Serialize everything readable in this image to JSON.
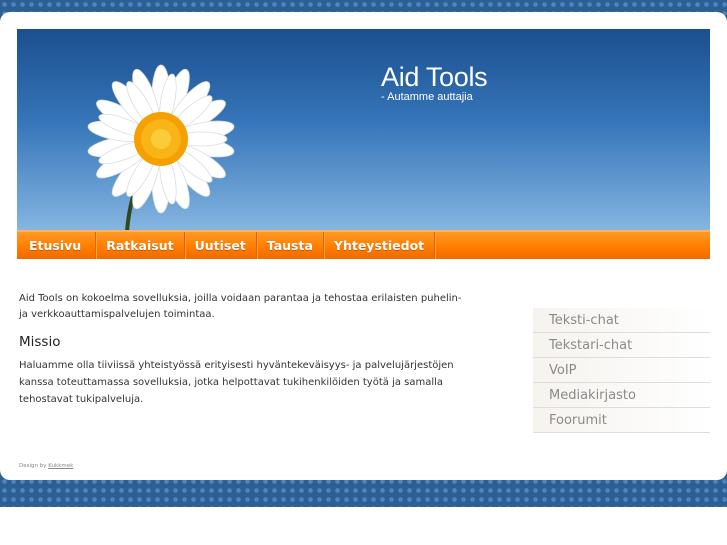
{
  "site": {
    "title": "Aid Tools",
    "subtitle": "- Autamme auttajia"
  },
  "nav": {
    "items": [
      {
        "label": "Etusivu"
      },
      {
        "label": "Ratkaisut"
      },
      {
        "label": "Uutiset"
      },
      {
        "label": "Tausta"
      },
      {
        "label": "Yhteystiedot"
      }
    ]
  },
  "main": {
    "intro": "Aid Tools on kokoelma sovelluksia, joilla voidaan parantaa ja tehostaa erilaisten puhelin- ja verkkoauttamispalvelujen toimintaa.",
    "mission_title": "Missio",
    "mission_text": "Haluamme olla tiiviissä yhteistyössä erityisesti hyväntekeväisyys- ja palvelujärjestöjen kanssa toteuttamassa sovelluksia, jotka helpottavat tukihenkilöiden työtä ja samalla tehostavat tukipalveluja."
  },
  "sidebar": {
    "items": [
      {
        "label": "Teksti-chat"
      },
      {
        "label": "Tekstari-chat"
      },
      {
        "label": "VoIP"
      },
      {
        "label": "Mediakirjasto"
      },
      {
        "label": "Foorumit"
      }
    ]
  },
  "footer": {
    "prefix": "Design by",
    "link": "Kukkmek"
  },
  "colors": {
    "nav_orange": "#ff7d00",
    "header_blue": "#1c4f8e",
    "background_pattern": "#2c5f94"
  }
}
